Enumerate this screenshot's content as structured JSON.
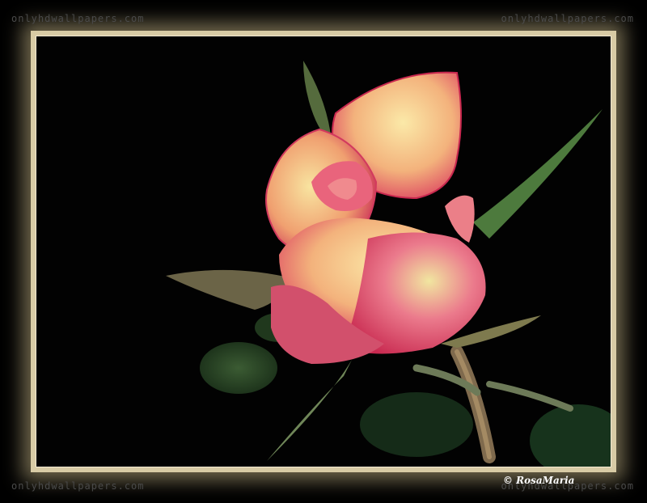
{
  "watermarks": {
    "top_left": "onlyhdwallpapers.com",
    "top_right": "onlyhdwallpapers.com",
    "bottom_left": "onlyhdwallpapers.com",
    "bottom_right": "onlyhdwallpapers.com"
  },
  "credit": "© RosaMaria",
  "colors": {
    "background": "#000000",
    "frame_glow": "#d8cba5",
    "petal_pink": "#e2476a",
    "petal_peach": "#f6c78c",
    "petal_cream": "#f8e6a0",
    "leaf_green": "#3f6a3a"
  }
}
